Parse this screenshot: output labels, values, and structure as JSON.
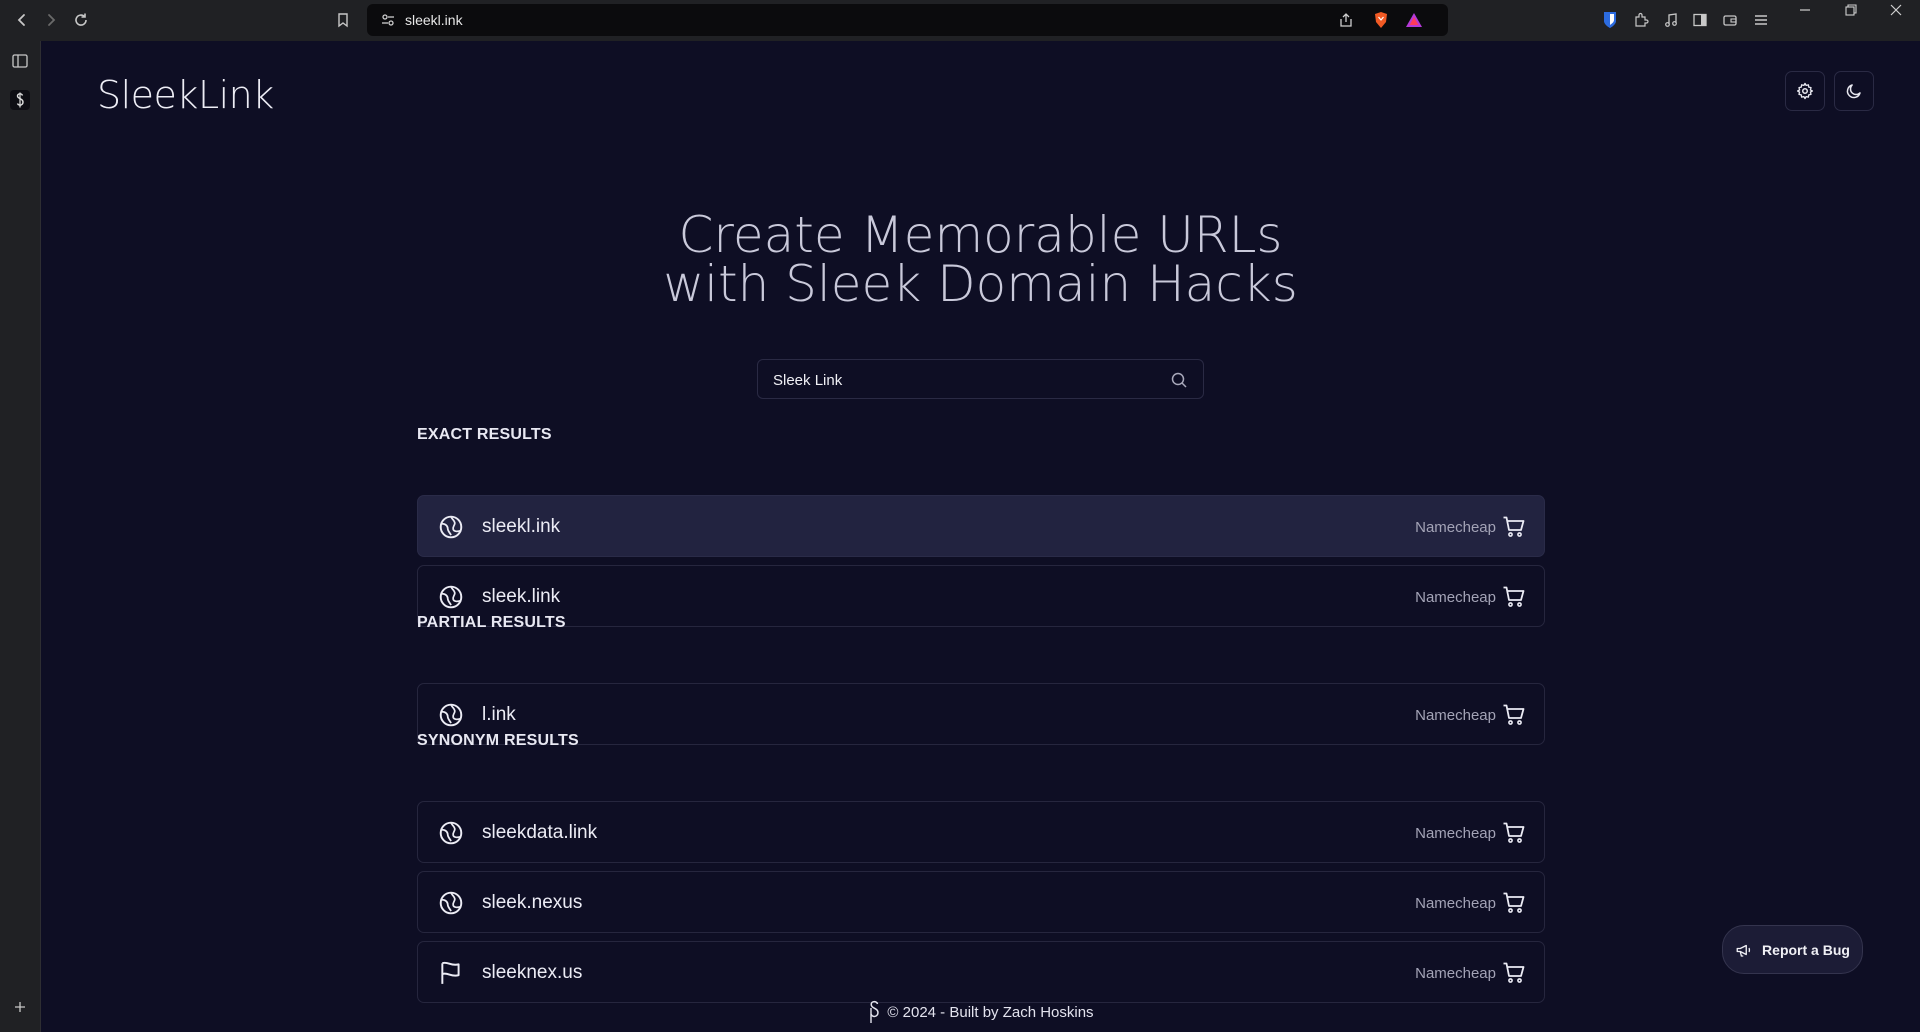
{
  "browser": {
    "url": "sleekl.ink",
    "window_controls": [
      "minimize-icon",
      "restore-icon",
      "close-icon"
    ]
  },
  "header": {
    "logo": "SleekLink",
    "settings_icon": "gear-icon",
    "theme_icon": "moon-icon"
  },
  "hero": {
    "line1": "Create Memorable URLs",
    "line2": "with Sleek Domain Hacks"
  },
  "search": {
    "value": "Sleek Link",
    "placeholder": ""
  },
  "sections": {
    "exact": {
      "label": "EXACT RESULTS",
      "items": [
        {
          "name": "sleekl.ink",
          "vendor": "Namecheap",
          "icon": "globe-icon"
        },
        {
          "name": "sleek.link",
          "vendor": "Namecheap",
          "icon": "globe-icon"
        }
      ]
    },
    "partial": {
      "label": "PARTIAL RESULTS",
      "items": [
        {
          "name": "l.ink",
          "vendor": "Namecheap",
          "icon": "globe-icon"
        }
      ]
    },
    "synonym": {
      "label": "SYNONYM RESULTS",
      "items": [
        {
          "name": "sleekdata.link",
          "vendor": "Namecheap",
          "icon": "globe-icon"
        },
        {
          "name": "sleek.nexus",
          "vendor": "Namecheap",
          "icon": "globe-icon"
        },
        {
          "name": "sleeknex.us",
          "vendor": "Namecheap",
          "icon": "flag-icon"
        }
      ]
    }
  },
  "footer": {
    "text": "© 2024 - Built by Zach Hoskins"
  },
  "report_bug": {
    "label": "Report a Bug"
  },
  "colors": {
    "background": "#0e0e24",
    "card_active": "#222340",
    "border": "#26263e"
  }
}
